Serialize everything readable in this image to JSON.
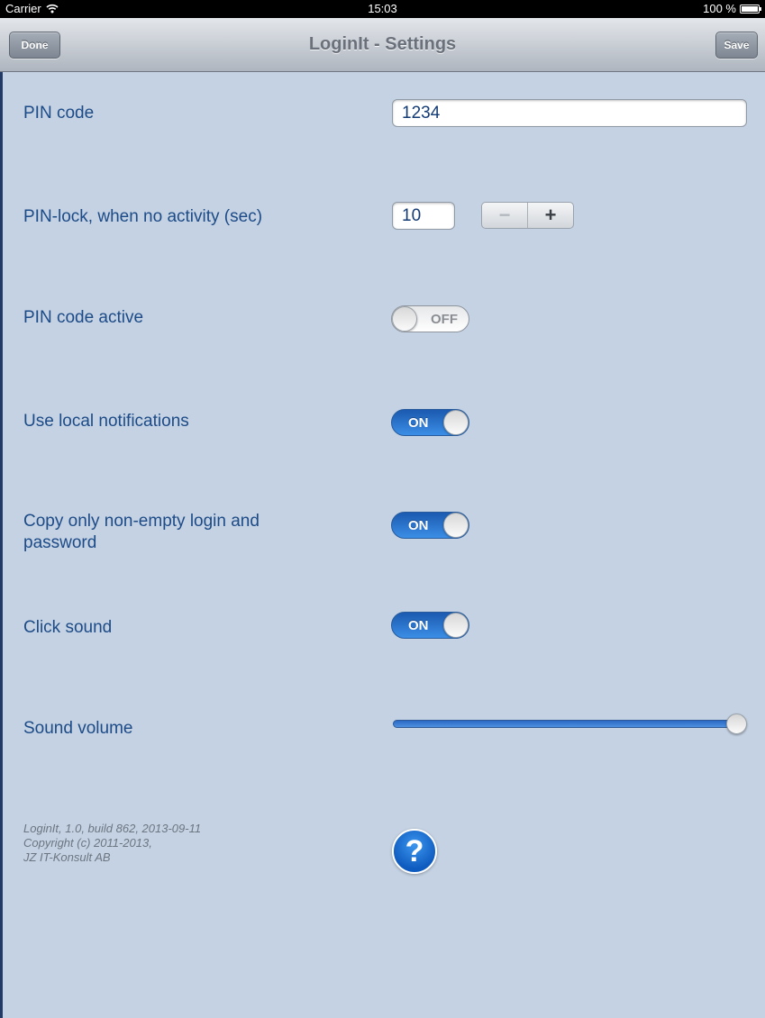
{
  "status_bar": {
    "carrier": "Carrier",
    "time": "15:03",
    "battery": "100 %",
    "wifi_icon": "wifi-icon",
    "battery_icon": "battery-icon"
  },
  "nav": {
    "title": "LoginIt - Settings",
    "done_label": "Done",
    "save_label": "Save"
  },
  "settings": {
    "pin_code": {
      "label": "PIN code",
      "value": "1234"
    },
    "pin_lock": {
      "label": "PIN-lock, when no activity (sec)",
      "value": "10",
      "minus": "−",
      "plus": "+"
    },
    "pin_active": {
      "label": "PIN code active",
      "state": "OFF"
    },
    "local_notifications": {
      "label": "Use local notifications",
      "state": "ON"
    },
    "copy_non_empty": {
      "label_line1": "Copy only non-empty login and",
      "label_line2": "password",
      "state": "ON"
    },
    "click_sound": {
      "label": "Click sound",
      "state": "ON"
    },
    "sound_volume": {
      "label": "Sound volume",
      "level": 1.0
    }
  },
  "footer": {
    "line1": "LoginIt, 1.0, build 862, 2013-09-11",
    "line2": "Copyright (c) 2011-2013,",
    "line3": "JZ IT-Konsult AB",
    "help_symbol": "?",
    "help_icon": "help-icon"
  },
  "colors": {
    "background": "#c4d2e3",
    "label": "#1d4b87",
    "switch_on": "#2a72d0"
  }
}
